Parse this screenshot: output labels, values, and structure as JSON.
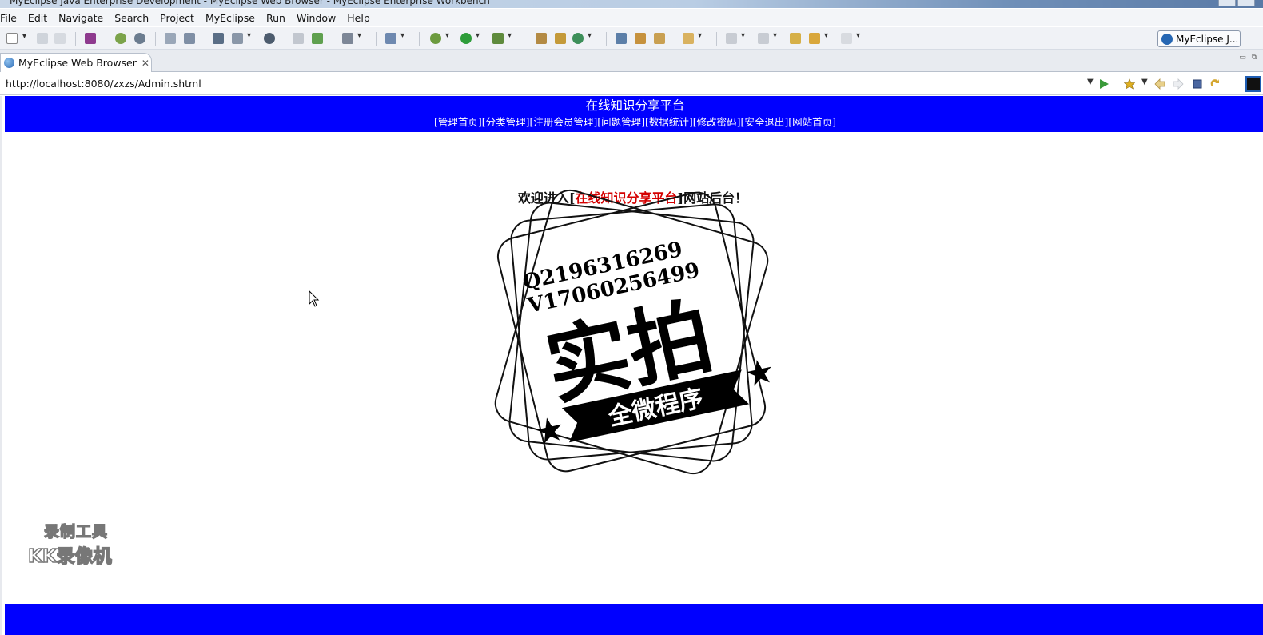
{
  "window": {
    "title": "MyEclipse Java Enterprise Development - MyEclipse Web Browser - MyEclipse Enterprise Workbench"
  },
  "menu": [
    "File",
    "Edit",
    "Navigate",
    "Search",
    "Project",
    "MyEclipse",
    "Run",
    "Window",
    "Help"
  ],
  "perspective": {
    "label": "MyEclipse J..."
  },
  "editor_tab": {
    "label": "MyEclipse Web Browser"
  },
  "browser": {
    "url": "http://localhost:8080/zxzs/Admin.shtml"
  },
  "site": {
    "title": "在线知识分享平台",
    "nav": [
      "[管理首页]",
      "[分类管理]",
      "[注册会员管理]",
      "[问题管理]",
      "[数据统计]",
      "[修改密码]",
      "[安全退出]",
      "[网站首页]"
    ],
    "welcome_prefix": "欢迎进入[",
    "welcome_name": "在线知识分享平台",
    "welcome_suffix": "]网站后台！"
  },
  "stamp": {
    "line1": "Q2196316269",
    "line2": "V17060256499",
    "big": "实拍",
    "banner": "全微程序"
  },
  "watermark": {
    "line1": "录制工具",
    "line2": "KK录像机"
  },
  "colors": {
    "header_blue": "#0000ff",
    "welcome_red": "#d40000",
    "toolbar_bg": "#f0f2f6"
  }
}
